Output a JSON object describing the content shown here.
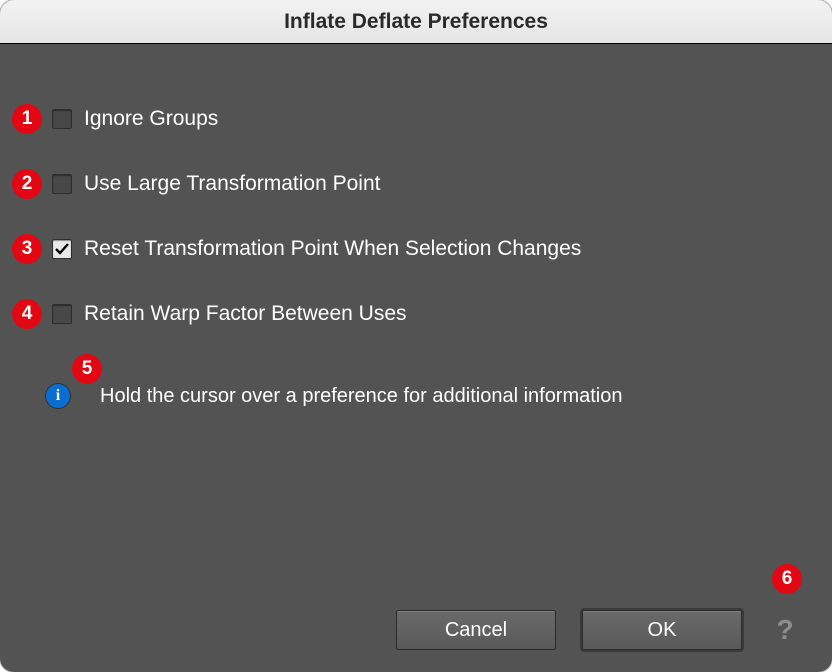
{
  "window": {
    "title": "Inflate Deflate Preferences"
  },
  "annotations": {
    "n1": "1",
    "n2": "2",
    "n3": "3",
    "n4": "4",
    "n5": "5",
    "n6": "6"
  },
  "options": {
    "ignore_groups": {
      "label": "Ignore Groups",
      "checked": false
    },
    "large_point": {
      "label": "Use Large Transformation Point",
      "checked": false
    },
    "reset_point": {
      "label": "Reset Transformation Point When Selection Changes",
      "checked": true
    },
    "retain_warp": {
      "label": "Retain Warp Factor Between Uses",
      "checked": false
    }
  },
  "info": {
    "icon_letter": "i",
    "text": "Hold the cursor over a preference for additional information"
  },
  "buttons": {
    "cancel": "Cancel",
    "ok": "OK",
    "help": "?"
  }
}
